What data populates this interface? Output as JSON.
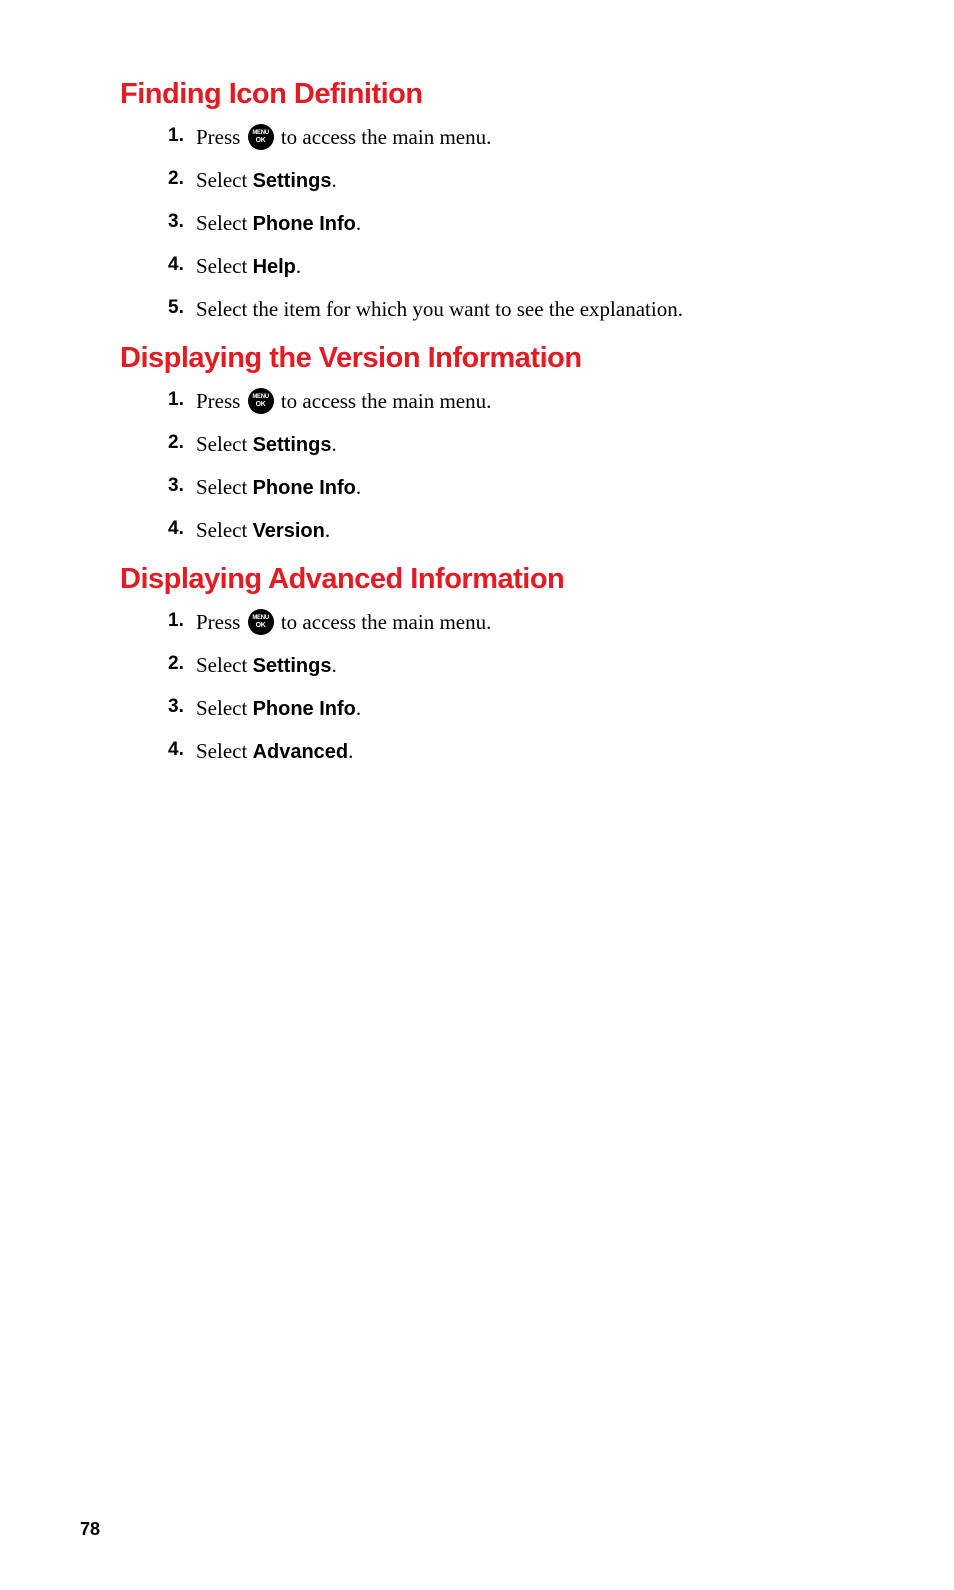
{
  "icon": {
    "line1": "MENU",
    "line2": "OK"
  },
  "sections": [
    {
      "heading": "Finding Icon Definition",
      "steps": [
        {
          "num": "1.",
          "pre": "Press ",
          "icon": true,
          "post": " to access the main menu."
        },
        {
          "num": "2.",
          "pre": "Select ",
          "bold": "Settings",
          "post": "."
        },
        {
          "num": "3.",
          "pre": "Select ",
          "bold": "Phone Info",
          "post": "."
        },
        {
          "num": "4.",
          "pre": "Select ",
          "bold": "Help",
          "post": "."
        },
        {
          "num": "5.",
          "pre": "Select the item for which you want to see the explanation."
        }
      ]
    },
    {
      "heading": "Displaying the Version Information",
      "steps": [
        {
          "num": "1.",
          "pre": "Press ",
          "icon": true,
          "post": " to access the main menu."
        },
        {
          "num": "2.",
          "pre": "Select ",
          "bold": "Settings",
          "post": "."
        },
        {
          "num": "3.",
          "pre": "Select ",
          "bold": "Phone Info",
          "post": "."
        },
        {
          "num": "4.",
          "pre": "Select ",
          "bold": "Version",
          "post": "."
        }
      ]
    },
    {
      "heading": "Displaying Advanced Information",
      "steps": [
        {
          "num": "1.",
          "pre": "Press ",
          "icon": true,
          "post": " to access the main menu."
        },
        {
          "num": "2.",
          "pre": "Select ",
          "bold": "Settings",
          "post": "."
        },
        {
          "num": "3.",
          "pre": "Select ",
          "bold": "Phone Info",
          "post": "."
        },
        {
          "num": "4.",
          "pre": "Select ",
          "bold": "Advanced",
          "post": "."
        }
      ]
    }
  ],
  "page_number": "78"
}
